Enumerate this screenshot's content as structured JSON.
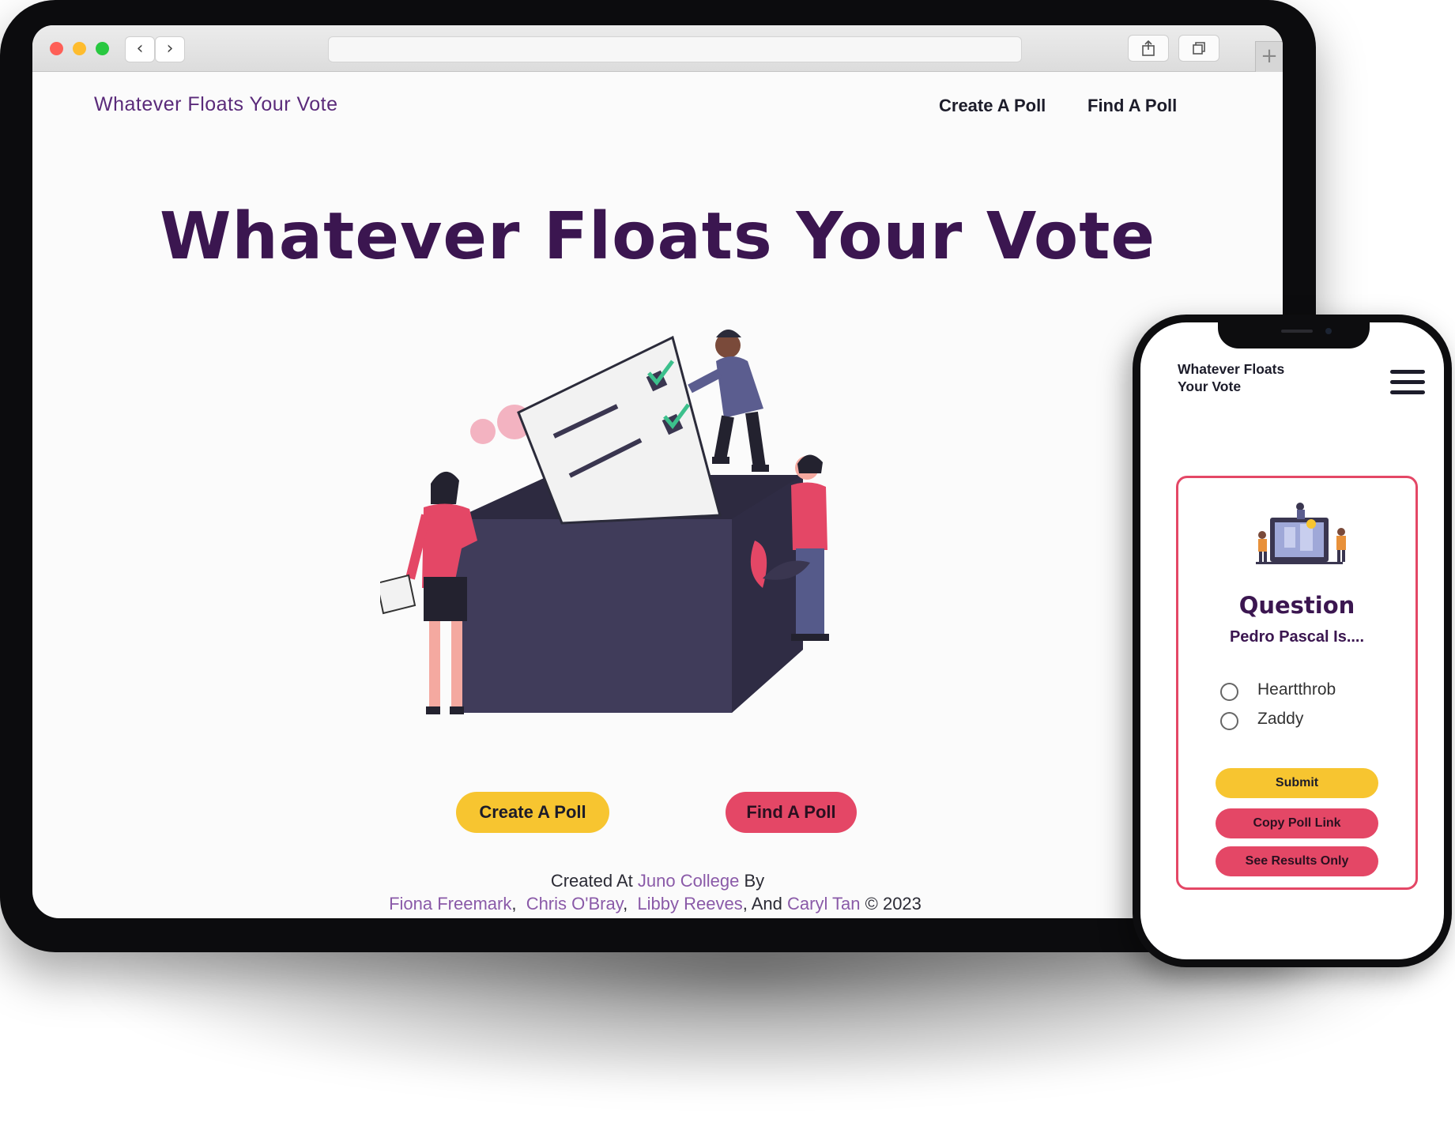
{
  "desktop": {
    "site_title": "Whatever Floats Your Vote",
    "nav": {
      "create": "Create A Poll",
      "find": "Find A Poll"
    },
    "hero_title": "Whatever Floats Your Vote",
    "cta": {
      "create": "Create A Poll",
      "find": "Find A Poll"
    },
    "footer": {
      "created_at": "Created At ",
      "college": "Juno College",
      "by": " By",
      "authors": [
        "Fiona Freemark",
        "Chris O'Bray",
        "Libby Reeves",
        "Caryl Tan"
      ],
      "and": " And ",
      "copyright": " © 2023"
    }
  },
  "mobile": {
    "site_title": "Whatever Floats Your Vote",
    "poll_card": {
      "title": "Question",
      "question": "Pedro Pascal Is....",
      "options": [
        "Heartthrob",
        "Zaddy"
      ],
      "submit": "Submit",
      "copy_link": "Copy Poll Link",
      "results_only": "See Results Only"
    }
  },
  "colors": {
    "brand_purple": "#3b1650",
    "accent_yellow": "#f7c530",
    "accent_pink": "#e44766",
    "link_purple": "#8a5aa8"
  },
  "icons": [
    "back-arrow-icon",
    "forward-arrow-icon",
    "share-icon",
    "tabs-icon",
    "new-tab-plus-icon",
    "hamburger-menu-icon"
  ]
}
